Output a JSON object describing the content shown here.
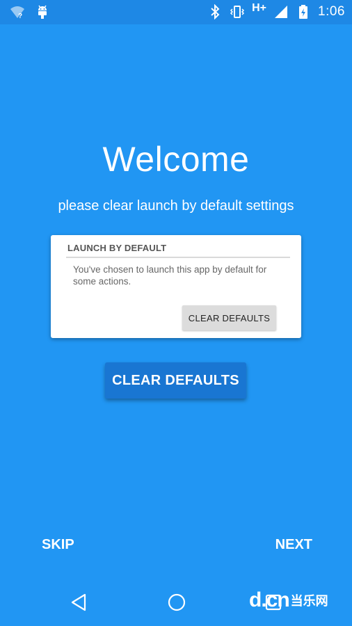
{
  "status_bar": {
    "network_type": "H+",
    "time": "1:06",
    "icons": [
      "wifi-question-icon",
      "android-debug-icon",
      "bluetooth-icon",
      "vibrate-icon",
      "signal-icon",
      "battery-charging-icon"
    ]
  },
  "main": {
    "title": "Welcome",
    "subtitle": "please clear launch by default settings",
    "card": {
      "header": "LAUNCH BY DEFAULT",
      "body": "You've chosen to launch this app by default for some actions.",
      "button_label": "CLEAR DEFAULTS"
    },
    "primary_button_label": "CLEAR DEFAULTS"
  },
  "footer": {
    "skip_label": "SKIP",
    "next_label": "NEXT"
  },
  "nav_bar": {
    "icons": [
      "back-icon",
      "home-icon",
      "recents-icon"
    ]
  },
  "watermark": {
    "logo": "d.cn",
    "text": "当乐网"
  },
  "colors": {
    "background": "#2196F3",
    "status_bar": "#1E88E5",
    "primary_button": "#1976D2",
    "card": "#FFFFFF",
    "card_button": "#DCDCDC"
  }
}
